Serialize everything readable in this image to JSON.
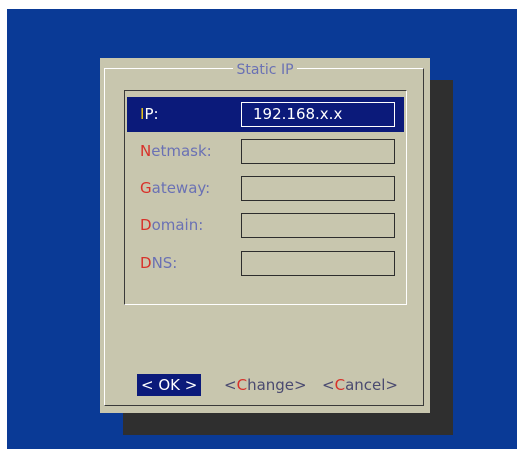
{
  "dialog": {
    "title": "Static IP",
    "fields": [
      {
        "hotkey": "I",
        "rest": "P:",
        "value": ""
      },
      {
        "hotkey": "N",
        "rest": "etmask:",
        "value": ""
      },
      {
        "hotkey": "G",
        "rest": "ateway:",
        "value": ""
      },
      {
        "hotkey": "D",
        "rest": "omain:",
        "value": ""
      },
      {
        "hotkey": "D",
        "rest": "NS:",
        "value": ""
      }
    ],
    "ip_value": "192.168.x.x",
    "buttons": {
      "ok": {
        "pre": "< ",
        "hot": "O",
        "post": "K >"
      },
      "change": {
        "pre": "<",
        "hot": "C",
        "post": "hange>"
      },
      "cancel": {
        "pre": "<",
        "hot": "C",
        "post": "ancel>"
      }
    }
  },
  "colors": {
    "background": "#0a3a96",
    "dialog": "#c8c6ae",
    "selected": "#0b1a7a",
    "hotkey": "#d8312a",
    "label": "#6a71b4"
  }
}
